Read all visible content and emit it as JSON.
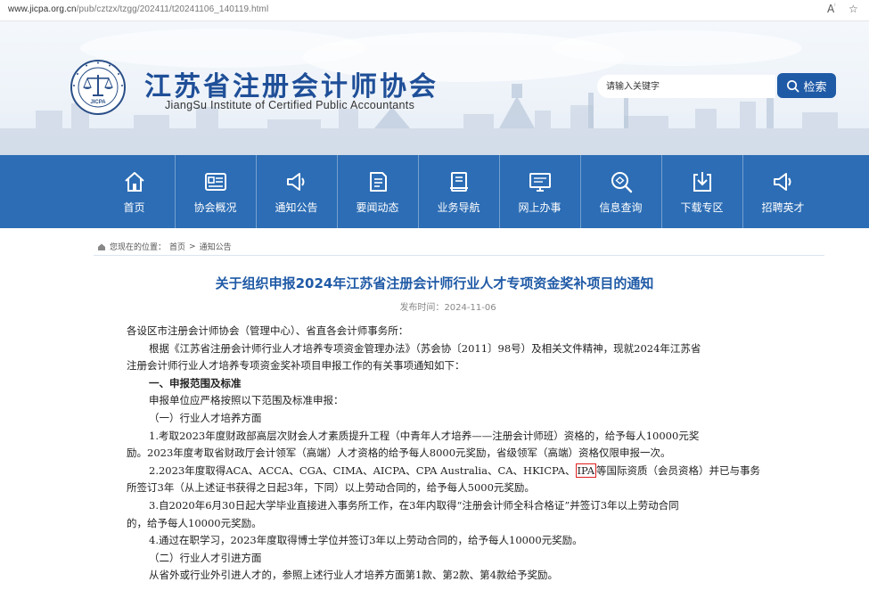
{
  "browser": {
    "url_host": "www.jicpa.org.cn",
    "url_path": "/pub/cztzx/tzgg/202411/t20241106_140119.html",
    "read_aloud_label": "A",
    "icons": [
      "read-aloud-icon",
      "star-icon"
    ]
  },
  "header": {
    "title": "江苏省注册会计师协会",
    "subtitle": "JiangSu Institute of Certified Public Accountants",
    "seal_text": "JICPA",
    "search": {
      "placeholder": "请输入关键字",
      "button_label": "检索"
    }
  },
  "nav": {
    "items": [
      {
        "label": "首页",
        "icon": "home-icon"
      },
      {
        "label": "协会概况",
        "icon": "info-card-icon"
      },
      {
        "label": "通知公告",
        "icon": "megaphone-icon"
      },
      {
        "label": "要闻动态",
        "icon": "news-doc-icon"
      },
      {
        "label": "业务导航",
        "icon": "book-icon"
      },
      {
        "label": "网上办事",
        "icon": "monitor-icon"
      },
      {
        "label": "信息查询",
        "icon": "search-icon"
      },
      {
        "label": "下载专区",
        "icon": "download-icon"
      },
      {
        "label": "招聘英才",
        "icon": "megaphone-icon"
      }
    ]
  },
  "breadcrumb": {
    "prefix": "您现在的位置：",
    "items": [
      "首页",
      "通知公告"
    ],
    "separator": ">"
  },
  "article": {
    "title": "关于组织申报2024年江苏省注册会计师行业人才专项资金奖补项目的通知",
    "date_label": "发布时间：",
    "date": "2024-11-06",
    "paragraphs": {
      "p1": "各设区市注册会计师协会（管理中心）、省直各会计师事务所：",
      "p2a": "根据《江苏省注册会计师行业人才培养专项资金管理办法》（苏会协〔2011〕98号）及相关文件精神，现就2024年江苏省",
      "p2b": "注册会计师行业人才培养专项资金奖补项目申报工作的有关事项通知如下：",
      "h1": "一、申报范围及标准",
      "p3": "申报单位应严格按照以下范围及标准申报：",
      "s1": "（一）行业人才培养方面",
      "i1a": "1.考取2023年度财政部高层次财会人才素质提升工程（中青年人才培养——注册会计师班）资格的，给予每人10000元奖",
      "i1b": "励。2023年度考取省财政厅会计领军（高端）人才资格的给予每人8000元奖励，省级领军（高端）资格仅限申报一次。",
      "i2a_pre": "2.2023年度取得ACA、ACCA、CGA、CIMA、AICPA、CPA Australia、CA、HKICPA、",
      "i2a_hl": "IPA",
      "i2a_post": "等国际资质（会员资格）并已与事务",
      "i2b": "所签订3年（从上述证书获得之日起3年，下同）以上劳动合同的，给予每人5000元奖励。",
      "i3a": "3.自2020年6月30日起大学毕业直接进入事务所工作，在3年内取得“注册会计师全科合格证”并签订3年以上劳动合同",
      "i3b": "的，给予每人10000元奖励。",
      "i4": "4.通过在职学习，2023年度取得博士学位并签订3年以上劳动合同的，给予每人10000元奖励。",
      "s2": "（二）行业人才引进方面",
      "p4": "从省外或行业外引进人才的，参照上述行业人才培养方面第1款、第2款、第4款给予奖励。"
    }
  },
  "colors": {
    "brand_blue": "#1f5aa6",
    "nav_blue": "#2c6db5",
    "highlight_red": "#e02020"
  }
}
